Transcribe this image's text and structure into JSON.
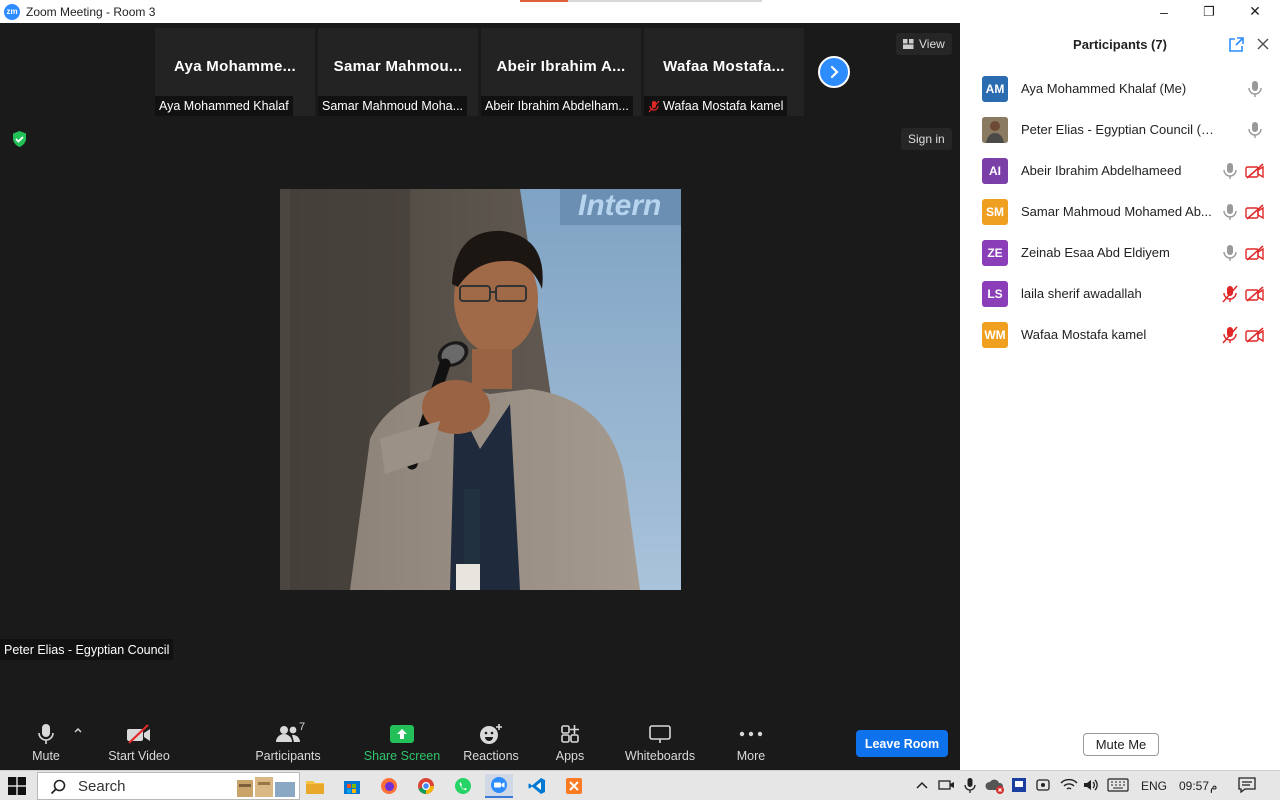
{
  "window": {
    "logo_text": "zm",
    "title": "Zoom Meeting - Room 3",
    "minimize": "–",
    "restore": "❐",
    "close": "✕"
  },
  "thumbnails": [
    {
      "display_name": "Aya Mohamme...",
      "label": "Aya Mohammed Khalaf",
      "muted": false
    },
    {
      "display_name": "Samar Mahmou...",
      "label": "Samar Mahmoud Moha...",
      "muted": false
    },
    {
      "display_name": "Abeir Ibrahim A...",
      "label": "Abeir Ibrahim Abdelham...",
      "muted": false
    },
    {
      "display_name": "Wafaa Mostafa...",
      "label": "Wafaa Mostafa kamel",
      "muted": true
    }
  ],
  "meeting": {
    "view_label": "View",
    "sign_in_label": "Sign in",
    "active_speaker": "Peter Elias - Egyptian Council",
    "photo_banner_text": "Intern"
  },
  "toolbar": {
    "mute": "Mute",
    "start_video": "Start Video",
    "participants": "Participants",
    "participants_count": "7",
    "share_screen": "Share Screen",
    "reactions": "Reactions",
    "apps": "Apps",
    "whiteboards": "Whiteboards",
    "more": "More",
    "leave_room": "Leave Room"
  },
  "panel": {
    "title": "Participants (7)",
    "mute_me": "Mute Me",
    "participants": [
      {
        "initials": "AM",
        "color": "#2b6cb0",
        "name": "Aya Mohammed Khalaf (Me)",
        "mic": "on",
        "video_off": false
      },
      {
        "initials": "",
        "color": "#6b5a44",
        "name": "Peter Elias - Egyptian Council (Host)",
        "mic": "on",
        "video_off": false
      },
      {
        "initials": "AI",
        "color": "#7b3fa8",
        "name": "Abeir Ibrahim Abdelhameed",
        "mic": "on",
        "video_off": true
      },
      {
        "initials": "SM",
        "color": "#f0a020",
        "name": "Samar Mahmoud Mohamed Ab...",
        "mic": "on",
        "video_off": true
      },
      {
        "initials": "ZE",
        "color": "#8a3fb8",
        "name": "Zeinab Esaa Abd Eldiyem",
        "mic": "on",
        "video_off": true
      },
      {
        "initials": "LS",
        "color": "#8a3fb8",
        "name": "laila sherif awadallah",
        "mic": "muted",
        "video_off": true
      },
      {
        "initials": "WM",
        "color": "#f0a020",
        "name": "Wafaa Mostafa kamel",
        "mic": "muted",
        "video_off": true
      }
    ]
  },
  "taskbar": {
    "search_label": "Search",
    "language": "ENG",
    "time": "09:57",
    "period": "م"
  }
}
